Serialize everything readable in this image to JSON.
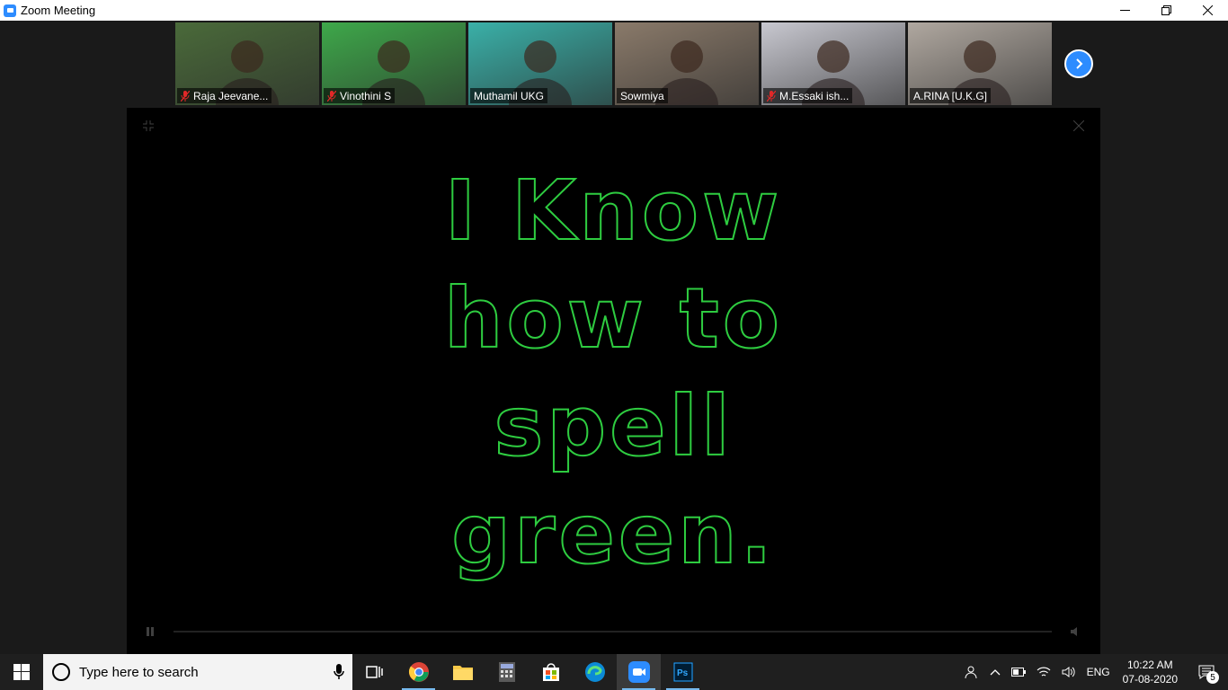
{
  "window": {
    "title": "Zoom Meeting"
  },
  "participants": [
    {
      "name": "Raja Jeevane...",
      "muted": true,
      "bg": "#4a6a3a"
    },
    {
      "name": "Vinothini S",
      "muted": true,
      "bg": "#3ea84a"
    },
    {
      "name": "Muthamil UKG",
      "muted": false,
      "bg": "#3ab0a8"
    },
    {
      "name": "Sowmiya",
      "muted": false,
      "bg": "#8a7a6a",
      "active": true
    },
    {
      "name": "M.Essaki ish...",
      "muted": true,
      "bg": "#c8c8d0"
    },
    {
      "name": "A.RINA  [U.K.G]",
      "muted": false,
      "bg": "#b0a8a0"
    }
  ],
  "shared_screen": {
    "lines": [
      "I Know",
      "how to",
      "spell",
      "green."
    ],
    "text_color": "#2ecc40"
  },
  "taskbar": {
    "search_placeholder": "Type here to search",
    "language": "ENG",
    "time": "10:22 AM",
    "date": "07-08-2020",
    "notification_count": "5"
  }
}
